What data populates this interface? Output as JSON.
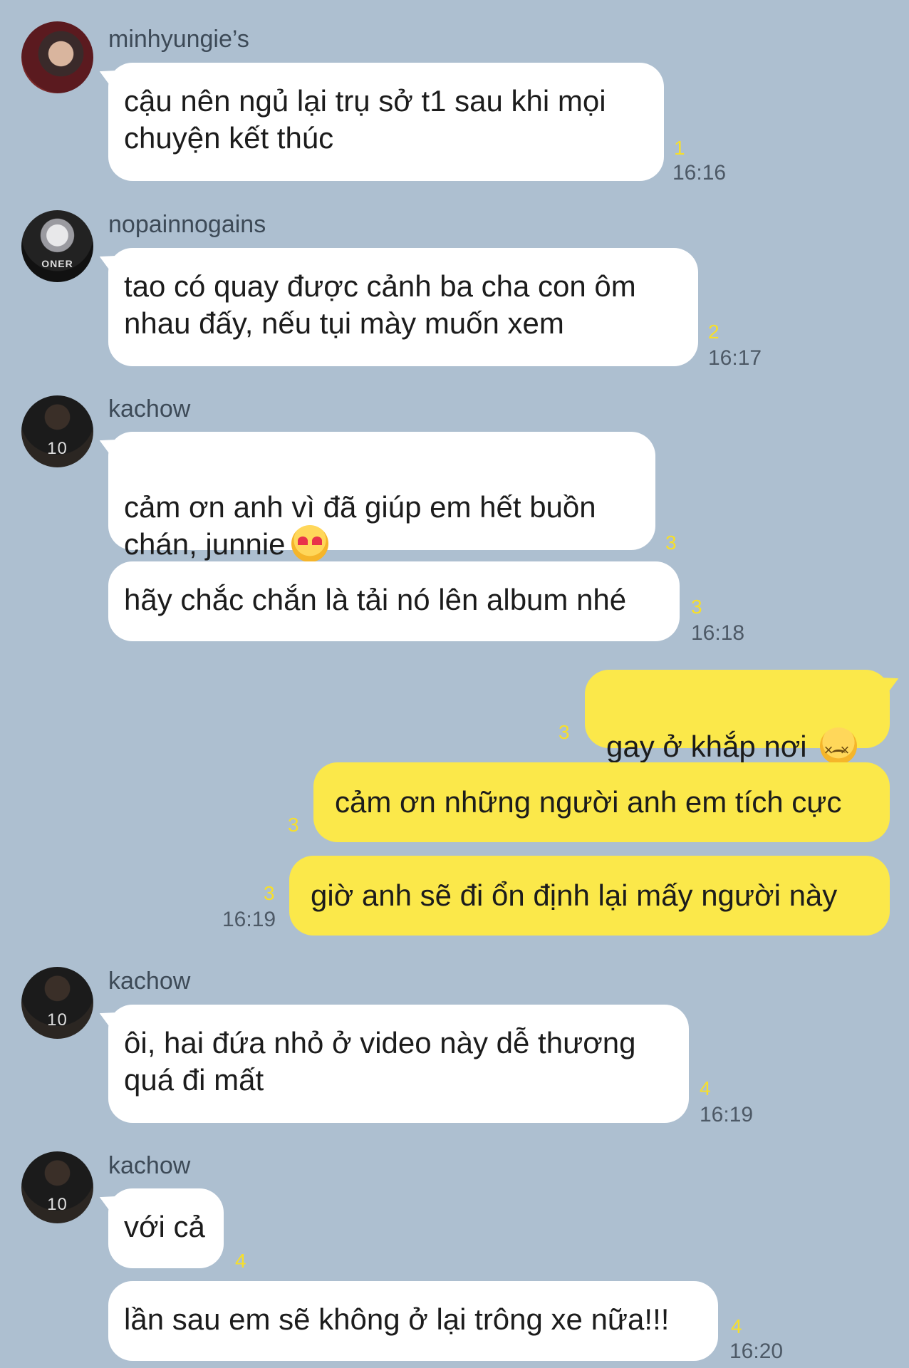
{
  "messages": [
    {
      "sender": "minhyungie’s",
      "text": "cậu nên ngủ lại trụ sở t1 sau khi mọi\nchuyện kết thúc",
      "unread": "1",
      "time": "16:16"
    },
    {
      "sender": "nopainnogains",
      "avatar_text": "ONER",
      "text": "tao có quay được cảnh ba cha con ôm\nnhau đấy, nếu tụi mày muốn xem",
      "unread": "2",
      "time": "16:17"
    },
    {
      "sender": "kachow",
      "avatar_text": "10",
      "text": "cảm ơn anh vì đã giúp em hết buồn\nchán, junnie",
      "emoji": "heart-eyes-emoji",
      "unread": "3"
    },
    {
      "text": "hãy chắc chắn là tải nó lên album nhé",
      "unread": "3",
      "time": "16:18"
    },
    {
      "text": "gay ở khắp nơi",
      "emoji": "persevering-face-emoji",
      "unread": "3"
    },
    {
      "text": "cảm ơn những người anh em tích cực",
      "unread": "3"
    },
    {
      "text": "giờ anh sẽ đi ổn định lại mấy người này",
      "unread": "3",
      "time": "16:19"
    },
    {
      "sender": "kachow",
      "avatar_text": "10",
      "text": "ôi, hai đứa nhỏ ở video này dễ thương\nquá đi mất",
      "unread": "4",
      "time": "16:19"
    },
    {
      "sender": "kachow",
      "avatar_text": "10",
      "text": "với cả",
      "unread": "4"
    },
    {
      "text": "lần sau em sẽ không ở lại trông xe nữa!!!",
      "unread": "4",
      "time": "16:20"
    }
  ],
  "colors": {
    "background": "#adbfd0",
    "incoming_bubble": "#ffffff",
    "outgoing_bubble": "#fbe84a",
    "unread_count": "#f7df2a"
  }
}
